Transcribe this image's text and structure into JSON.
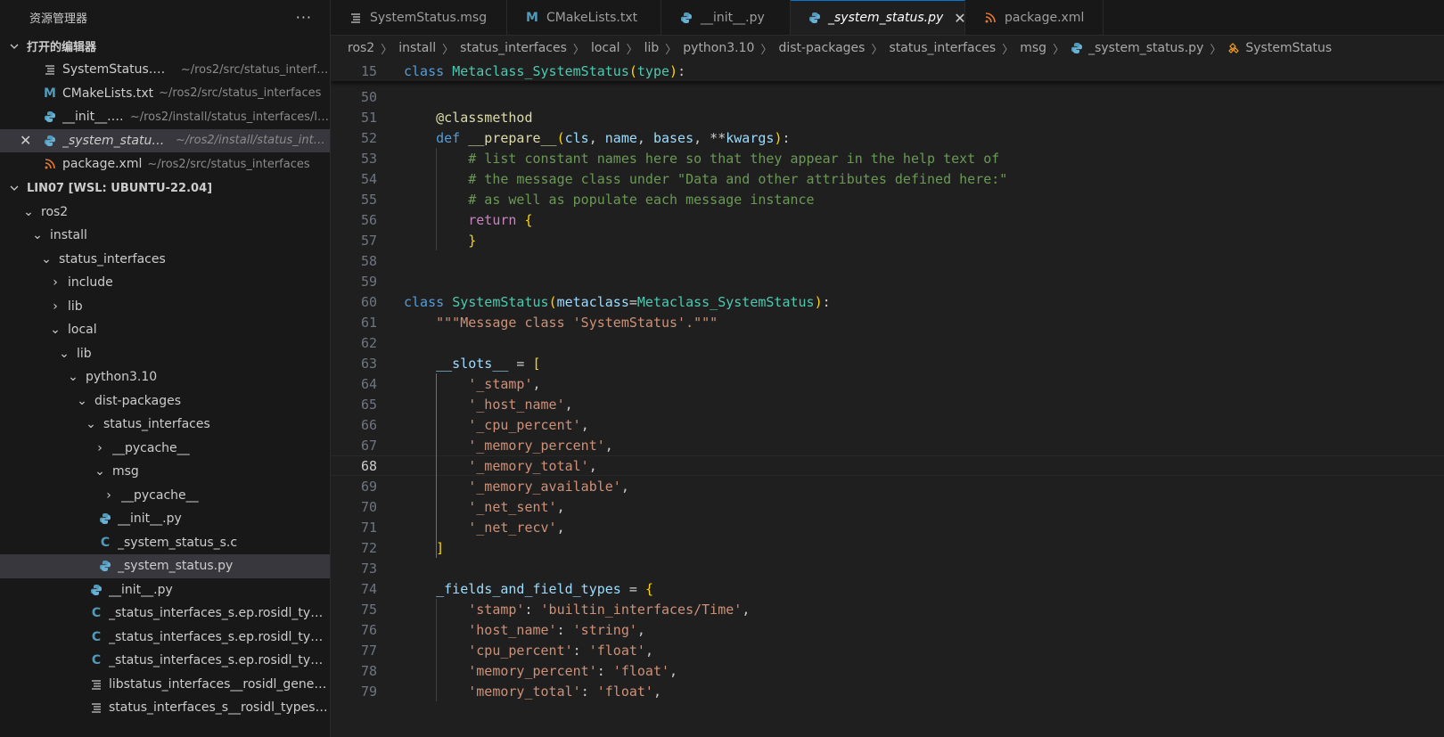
{
  "sidebar": {
    "title": "资源管理器",
    "more_label": "···",
    "open_editors": {
      "header": "打开的编辑器",
      "items": [
        {
          "label": "SystemStatus.msg",
          "path": "~/ros2/src/status_interfa...",
          "icon": "list-icon"
        },
        {
          "label": "CMakeLists.txt",
          "path": "~/ros2/src/status_interfaces",
          "icon": "cmake-icon"
        },
        {
          "label": "__init__.py",
          "path": "~/ros2/install/status_interfaces/lo...",
          "icon": "python-icon"
        },
        {
          "label": "_system_status.py",
          "path": "~/ros2/install/status_interf...",
          "icon": "python-icon"
        },
        {
          "label": "package.xml",
          "path": "~/ros2/src/status_interfaces",
          "icon": "rss-icon"
        }
      ]
    },
    "workspace": {
      "header": "LIN07 [WSL: UBUNTU-22.04]",
      "items": [
        {
          "label": "ros2"
        },
        {
          "label": "install"
        },
        {
          "label": "status_interfaces"
        },
        {
          "label": "include"
        },
        {
          "label": "lib"
        },
        {
          "label": "local"
        },
        {
          "label": "lib"
        },
        {
          "label": "python3.10"
        },
        {
          "label": "dist-packages"
        },
        {
          "label": "status_interfaces"
        },
        {
          "label": "__pycache__"
        },
        {
          "label": "msg"
        },
        {
          "label": "__pycache__"
        },
        {
          "label": "__init__.py"
        },
        {
          "label": "_system_status_s.c"
        },
        {
          "label": "_system_status.py"
        },
        {
          "label": "__init__.py"
        },
        {
          "label": "_status_interfaces_s.ep.rosidl_type..."
        },
        {
          "label": "_status_interfaces_s.ep.rosidl_type..."
        },
        {
          "label": "_status_interfaces_s.ep.rosidl_type..."
        },
        {
          "label": "libstatus_interfaces__rosidl_gener..."
        },
        {
          "label": "status_interfaces_s__rosidl_typesu..."
        }
      ]
    }
  },
  "tabs": [
    {
      "label": "SystemStatus.msg",
      "icon": "list-icon"
    },
    {
      "label": "CMakeLists.txt",
      "icon": "cmake-icon"
    },
    {
      "label": "__init__.py",
      "icon": "python-icon"
    },
    {
      "label": "_system_status.py",
      "icon": "python-icon"
    },
    {
      "label": "package.xml",
      "icon": "rss-icon"
    }
  ],
  "breadcrumb": [
    "ros2",
    "install",
    "status_interfaces",
    "local",
    "lib",
    "python3.10",
    "dist-packages",
    "status_interfaces",
    "msg",
    "_system_status.py",
    "SystemStatus"
  ],
  "editor": {
    "sticky_line": {
      "num": "15",
      "text": "class Metaclass_SystemStatus(type):"
    },
    "current_line": "68",
    "lines": [
      {
        "num": "50",
        "text": ""
      },
      {
        "num": "51",
        "text": "    @classmethod"
      },
      {
        "num": "52",
        "text": "    def __prepare__(cls, name, bases, **kwargs):"
      },
      {
        "num": "53",
        "text": "        # list constant names here so that they appear in the help text of"
      },
      {
        "num": "54",
        "text": "        # the message class under \"Data and other attributes defined here:\""
      },
      {
        "num": "55",
        "text": "        # as well as populate each message instance"
      },
      {
        "num": "56",
        "text": "        return {"
      },
      {
        "num": "57",
        "text": "        }"
      },
      {
        "num": "58",
        "text": ""
      },
      {
        "num": "59",
        "text": ""
      },
      {
        "num": "60",
        "text": "class SystemStatus(metaclass=Metaclass_SystemStatus):"
      },
      {
        "num": "61",
        "text": "    \"\"\"Message class 'SystemStatus'.\"\"\""
      },
      {
        "num": "62",
        "text": ""
      },
      {
        "num": "63",
        "text": "    __slots__ = ["
      },
      {
        "num": "64",
        "text": "        '_stamp',"
      },
      {
        "num": "65",
        "text": "        '_host_name',"
      },
      {
        "num": "66",
        "text": "        '_cpu_percent',"
      },
      {
        "num": "67",
        "text": "        '_memory_percent',"
      },
      {
        "num": "68",
        "text": "        '_memory_total',"
      },
      {
        "num": "69",
        "text": "        '_memory_available',"
      },
      {
        "num": "70",
        "text": "        '_net_sent',"
      },
      {
        "num": "71",
        "text": "        '_net_recv',"
      },
      {
        "num": "72",
        "text": "    ]"
      },
      {
        "num": "73",
        "text": ""
      },
      {
        "num": "74",
        "text": "    _fields_and_field_types = {"
      },
      {
        "num": "75",
        "text": "        'stamp': 'builtin_interfaces/Time',"
      },
      {
        "num": "76",
        "text": "        'host_name': 'string',"
      },
      {
        "num": "77",
        "text": "        'cpu_percent': 'float',"
      },
      {
        "num": "78",
        "text": "        'memory_percent': 'float',"
      },
      {
        "num": "79",
        "text": "        'memory_total': 'float',"
      }
    ]
  }
}
